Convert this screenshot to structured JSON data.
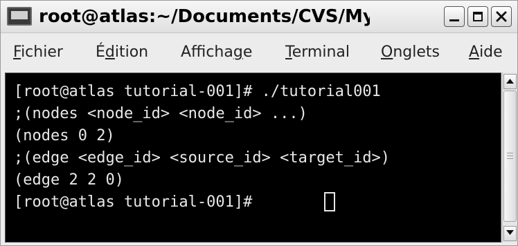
{
  "window": {
    "title": "root@atlas:~/Documents/CVS/My-tuli|"
  },
  "menu": {
    "items": [
      {
        "underline": "F",
        "rest": "ichier"
      },
      {
        "pre": "É",
        "underline": "d",
        "rest": "ition"
      },
      {
        "pre": "Afficha",
        "underline": "g",
        "rest": "e"
      },
      {
        "underline": "T",
        "rest": "erminal"
      },
      {
        "underline": "O",
        "rest": "nglets"
      },
      {
        "underline": "A",
        "rest": "ide"
      }
    ]
  },
  "terminal": {
    "lines": [
      "[root@atlas tutorial-001]# ./tutorial001",
      ";(nodes <node_id> <node_id> ...)",
      "(nodes 0 2)",
      ";(edge <edge_id> <source_id> <target_id>)",
      "(edge 2 2 0)",
      "[root@atlas tutorial-001]# "
    ]
  },
  "icons": {
    "app": "terminal-icon",
    "minimize": "minimize-icon",
    "maximize": "maximize-icon",
    "close": "close-icon",
    "scroll_up": "arrow-up-icon",
    "scroll_down": "arrow-down-icon"
  },
  "colors": {
    "terminal_background": "#000000",
    "terminal_text": "#e8e8e8",
    "chrome": "#ececec"
  }
}
